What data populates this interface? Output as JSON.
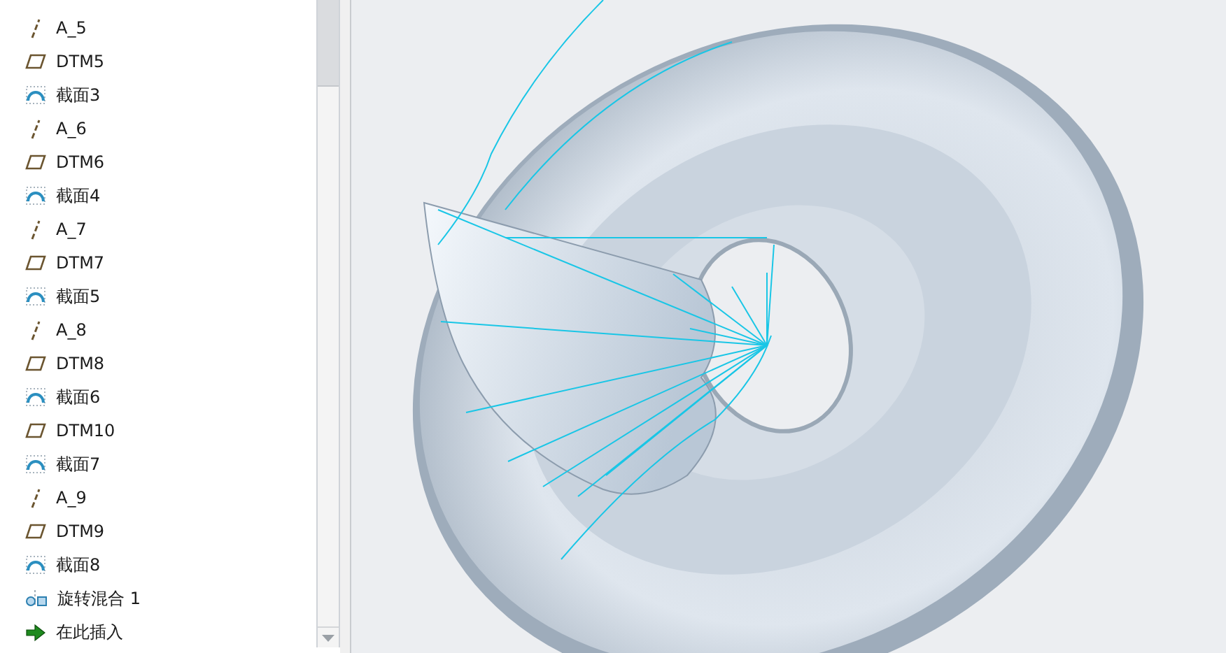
{
  "model_tree": {
    "items": [
      {
        "kind": "axis",
        "label": "A_5"
      },
      {
        "kind": "plane",
        "label": "DTM5"
      },
      {
        "kind": "section",
        "label": "截面3"
      },
      {
        "kind": "axis",
        "label": "A_6"
      },
      {
        "kind": "plane",
        "label": "DTM6"
      },
      {
        "kind": "section",
        "label": "截面4"
      },
      {
        "kind": "axis",
        "label": "A_7"
      },
      {
        "kind": "plane",
        "label": "DTM7"
      },
      {
        "kind": "section",
        "label": "截面5"
      },
      {
        "kind": "axis",
        "label": "A_8"
      },
      {
        "kind": "plane",
        "label": "DTM8"
      },
      {
        "kind": "section",
        "label": "截面6"
      },
      {
        "kind": "plane",
        "label": "DTM10"
      },
      {
        "kind": "section",
        "label": "截面7"
      },
      {
        "kind": "axis",
        "label": "A_9"
      },
      {
        "kind": "plane",
        "label": "DTM9"
      },
      {
        "kind": "section",
        "label": "截面8"
      },
      {
        "kind": "feature",
        "label": "旋转混合 1"
      },
      {
        "kind": "insert",
        "label": "在此插入"
      }
    ]
  }
}
